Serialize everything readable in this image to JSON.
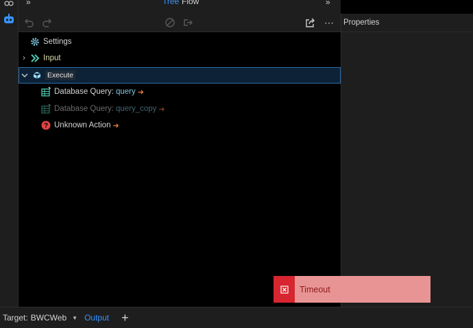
{
  "top_tabs": {
    "tree": "Tree",
    "flow": "Flow"
  },
  "properties": {
    "title": "Properties"
  },
  "tree": {
    "settings": "Settings",
    "input": "Input",
    "execute": "Execute",
    "children": [
      {
        "prefix": "Database Query:",
        "name": "query",
        "disabled": false
      },
      {
        "prefix": "Database Query:",
        "name": "query_copy",
        "disabled": true
      }
    ],
    "unknown": "Unknown Action"
  },
  "status_bar": {
    "target_label": "Target:",
    "target_value": "BWCWeb",
    "output": "Output"
  },
  "toast": {
    "message": "Timeout"
  },
  "colors": {
    "accent": "#3794ff",
    "name_link": "#7fc5e0",
    "input_label": "#dcdcaa",
    "toast_bg": "#e99494",
    "toast_icon_bg": "#d7262f",
    "error_icon": "#e04343"
  }
}
